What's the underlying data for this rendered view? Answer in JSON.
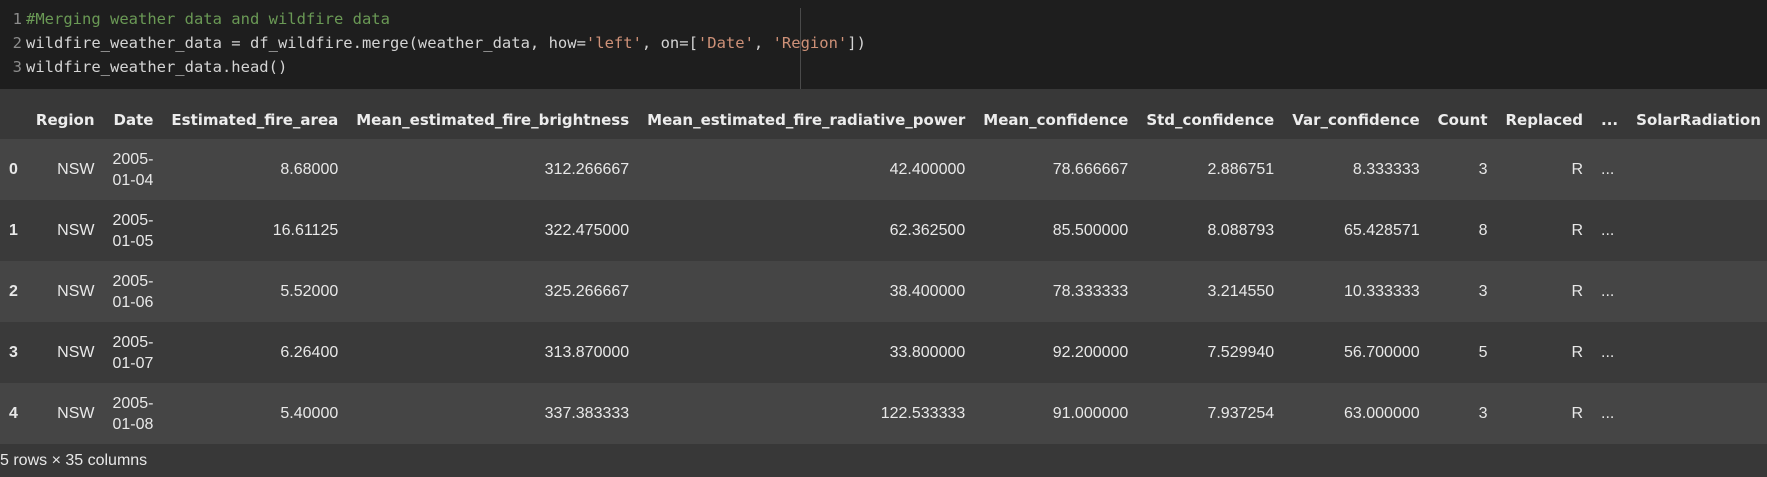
{
  "code": {
    "lines": [
      {
        "num": "1",
        "tokens": [
          {
            "t": "comment",
            "v": "#Merging weather data and wildfire data"
          }
        ]
      },
      {
        "num": "2",
        "tokens": [
          {
            "t": "plain",
            "v": "wildfire_weather_data = df_wildfire.merge(weather_data, how="
          },
          {
            "t": "string",
            "v": "'left'"
          },
          {
            "t": "plain",
            "v": ", on=["
          },
          {
            "t": "string",
            "v": "'Date'"
          },
          {
            "t": "plain",
            "v": ", "
          },
          {
            "t": "string",
            "v": "'Region'"
          },
          {
            "t": "plain",
            "v": "])"
          }
        ]
      },
      {
        "num": "3",
        "tokens": [
          {
            "t": "plain",
            "v": "wildfire_weather_data.head()"
          }
        ]
      }
    ]
  },
  "table": {
    "columns": [
      "",
      "Region",
      "Date",
      "Estimated_fire_area",
      "Mean_estimated_fire_brightness",
      "Mean_estimated_fire_radiative_power",
      "Mean_confidence",
      "Std_confidence",
      "Var_confidence",
      "Count",
      "Replaced",
      "...",
      "SolarRadiation"
    ],
    "rows": [
      [
        "0",
        "NSW",
        "2005-01-04",
        "8.68000",
        "312.266667",
        "42.400000",
        "78.666667",
        "2.886751",
        "8.333333",
        "3",
        "R",
        "...",
        ""
      ],
      [
        "1",
        "NSW",
        "2005-01-05",
        "16.61125",
        "322.475000",
        "62.362500",
        "85.500000",
        "8.088793",
        "65.428571",
        "8",
        "R",
        "...",
        ""
      ],
      [
        "2",
        "NSW",
        "2005-01-06",
        "5.52000",
        "325.266667",
        "38.400000",
        "78.333333",
        "3.214550",
        "10.333333",
        "3",
        "R",
        "...",
        ""
      ],
      [
        "3",
        "NSW",
        "2005-01-07",
        "6.26400",
        "313.870000",
        "33.800000",
        "92.200000",
        "7.529940",
        "56.700000",
        "5",
        "R",
        "...",
        ""
      ],
      [
        "4",
        "NSW",
        "2005-01-08",
        "5.40000",
        "337.383333",
        "122.533333",
        "91.000000",
        "7.937254",
        "63.000000",
        "3",
        "R",
        "...",
        ""
      ]
    ]
  },
  "shape_note": "5 rows × 35 columns"
}
